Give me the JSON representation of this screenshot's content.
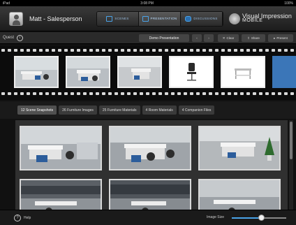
{
  "status": {
    "left": "iPad",
    "time": "3:08 PM",
    "right": "100%"
  },
  "header": {
    "username": "Matt - Salesperson",
    "modes": [
      {
        "label": "SCENES",
        "active": false
      },
      {
        "label": "PRESENTATION",
        "active": true
      },
      {
        "label": "DISCUSSIONS",
        "active": false
      }
    ],
    "brand_line1": "Visual Impression",
    "brand_line2": "MOBILE"
  },
  "toolbar": {
    "quest": "Quest",
    "presentation_title": "Demo Presentation",
    "buttons": [
      "Clear",
      "Share",
      "Present"
    ]
  },
  "tabs": [
    {
      "label": "12 Scene Snapshots",
      "active": true
    },
    {
      "label": "26 Furniture Images",
      "active": false
    },
    {
      "label": "25 Furniture Materials",
      "active": false
    },
    {
      "label": "4 Room Materials",
      "active": false
    },
    {
      "label": "4 Companion Files",
      "active": false
    }
  ],
  "bottom": {
    "help": "Help",
    "image_size_label": "Image Size",
    "image_size": 0.55
  },
  "colors": {
    "accent": "#4aa3e8",
    "background": "#111111"
  }
}
